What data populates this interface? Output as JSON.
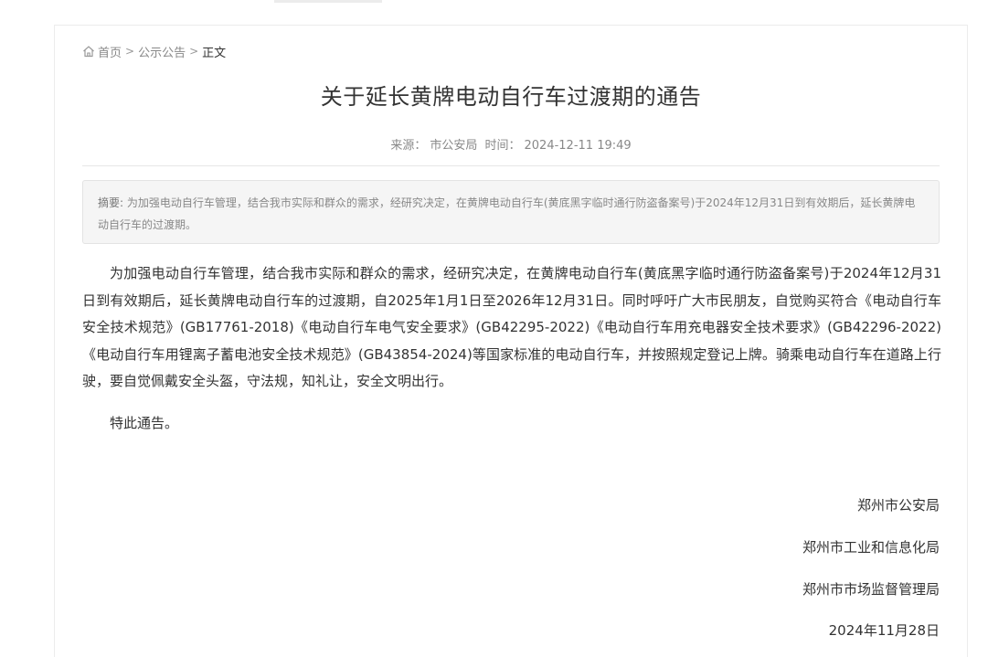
{
  "breadcrumb": {
    "home": "首页",
    "section": "公示公告",
    "current": "正文"
  },
  "article": {
    "title": "关于延长黄牌电动自行车过渡期的通告",
    "source_label": "来源：",
    "source": "市公安局",
    "time_label": "时间：",
    "time": "2024-12-11 19:49",
    "summary_label": "摘要:",
    "summary": "为加强电动自行车管理，结合我市实际和群众的需求，经研究决定，在黄牌电动自行车(黄底黑字临时通行防盗备案号)于2024年12月31日到有效期后，延长黄牌电动自行车的过渡期。",
    "paragraph1": "为加强电动自行车管理，结合我市实际和群众的需求，经研究决定，在黄牌电动自行车(黄底黑字临时通行防盗备案号)于2024年12月31日到有效期后，延长黄牌电动自行车的过渡期，自2025年1月1日至2026年12月31日。同时呼吁广大市民朋友，自觉购买符合《电动自行车安全技术规范》(GB17761-2018)《电动自行车电气安全要求》(GB42295-2022)《电动自行车用充电器安全技术要求》(GB42296-2022)《电动自行车用锂离子蓄电池安全技术规范》(GB43854-2024)等国家标准的电动自行车，并按照规定登记上牌。骑乘电动自行车在道路上行驶，要自觉佩戴安全头盔，守法规，知礼让，安全文明出行。",
    "paragraph2": "特此通告。",
    "signatures": [
      "郑州市公安局",
      "郑州市工业和信息化局",
      "郑州市市场监督管理局"
    ],
    "date": "2024年11月28日"
  },
  "icons": {
    "home": "home-icon",
    "separator": "chevron-right-icon"
  }
}
